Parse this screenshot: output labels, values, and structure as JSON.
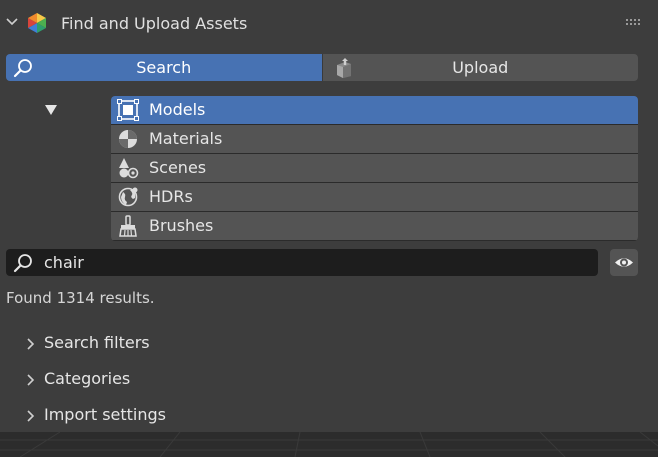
{
  "panel": {
    "title": "Find and Upload Assets"
  },
  "tabs": [
    {
      "label": "Search",
      "active": true,
      "icon": "search-icon"
    },
    {
      "label": "Upload",
      "active": false,
      "icon": "upload-icon"
    }
  ],
  "asset_types": [
    {
      "label": "Models",
      "icon": "models-icon",
      "selected": true
    },
    {
      "label": "Materials",
      "icon": "materials-icon",
      "selected": false
    },
    {
      "label": "Scenes",
      "icon": "scenes-icon",
      "selected": false
    },
    {
      "label": "HDRs",
      "icon": "hdrs-icon",
      "selected": false
    },
    {
      "label": "Brushes",
      "icon": "brushes-icon",
      "selected": false
    }
  ],
  "search": {
    "value": "chair"
  },
  "results_text": "Found 1314 results.",
  "subpanels": [
    {
      "label": "Search filters"
    },
    {
      "label": "Categories"
    },
    {
      "label": "Import settings"
    }
  ],
  "colors": {
    "accent": "#4772b3",
    "panel_bg": "#3d3d3d",
    "button_bg": "#545454",
    "field_bg": "#1d1d1d"
  }
}
